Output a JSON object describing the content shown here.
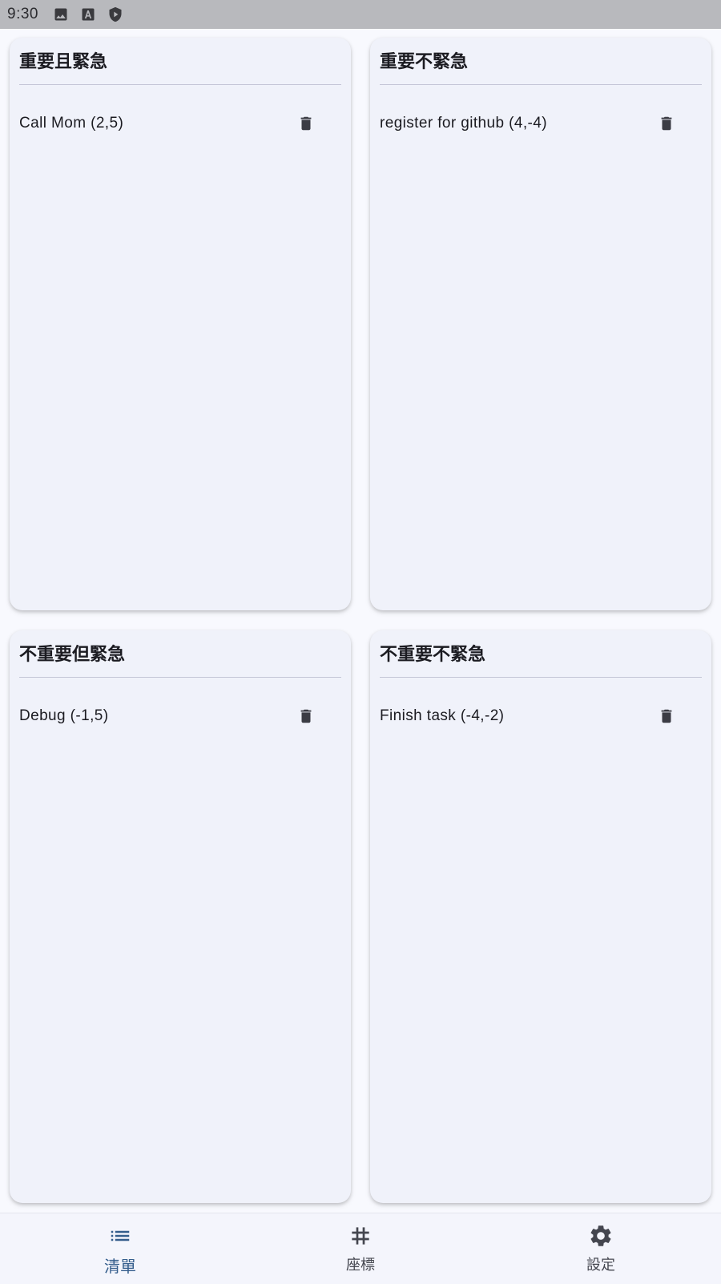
{
  "status_bar": {
    "time": "9:30",
    "icons": [
      "image-icon",
      "font-a-icon",
      "shield-play-icon"
    ]
  },
  "quadrants": [
    {
      "title": "重要且緊急",
      "tasks": [
        {
          "label": "Call Mom (2,5)"
        }
      ]
    },
    {
      "title": "重要不緊急",
      "tasks": [
        {
          "label": "register for github (4,-4)"
        }
      ]
    },
    {
      "title": "不重要但緊急",
      "tasks": [
        {
          "label": "Debug (-1,5)"
        }
      ]
    },
    {
      "title": "不重要不緊急",
      "tasks": [
        {
          "label": "Finish task (-4,-2)"
        }
      ]
    }
  ],
  "task_delete_icon": "trash-icon",
  "bottom_nav": {
    "items": [
      {
        "label": "清單",
        "icon": "list-icon",
        "active": true
      },
      {
        "label": "座標",
        "icon": "grid-hash-icon",
        "active": false
      },
      {
        "label": "設定",
        "icon": "gear-icon",
        "active": false
      }
    ]
  },
  "colors": {
    "accent": "#345d8c",
    "card_background": "#f0f2fa",
    "page_background": "#f8f9fe",
    "status_bar": "#b8b9bd",
    "icon": "#44464f"
  }
}
